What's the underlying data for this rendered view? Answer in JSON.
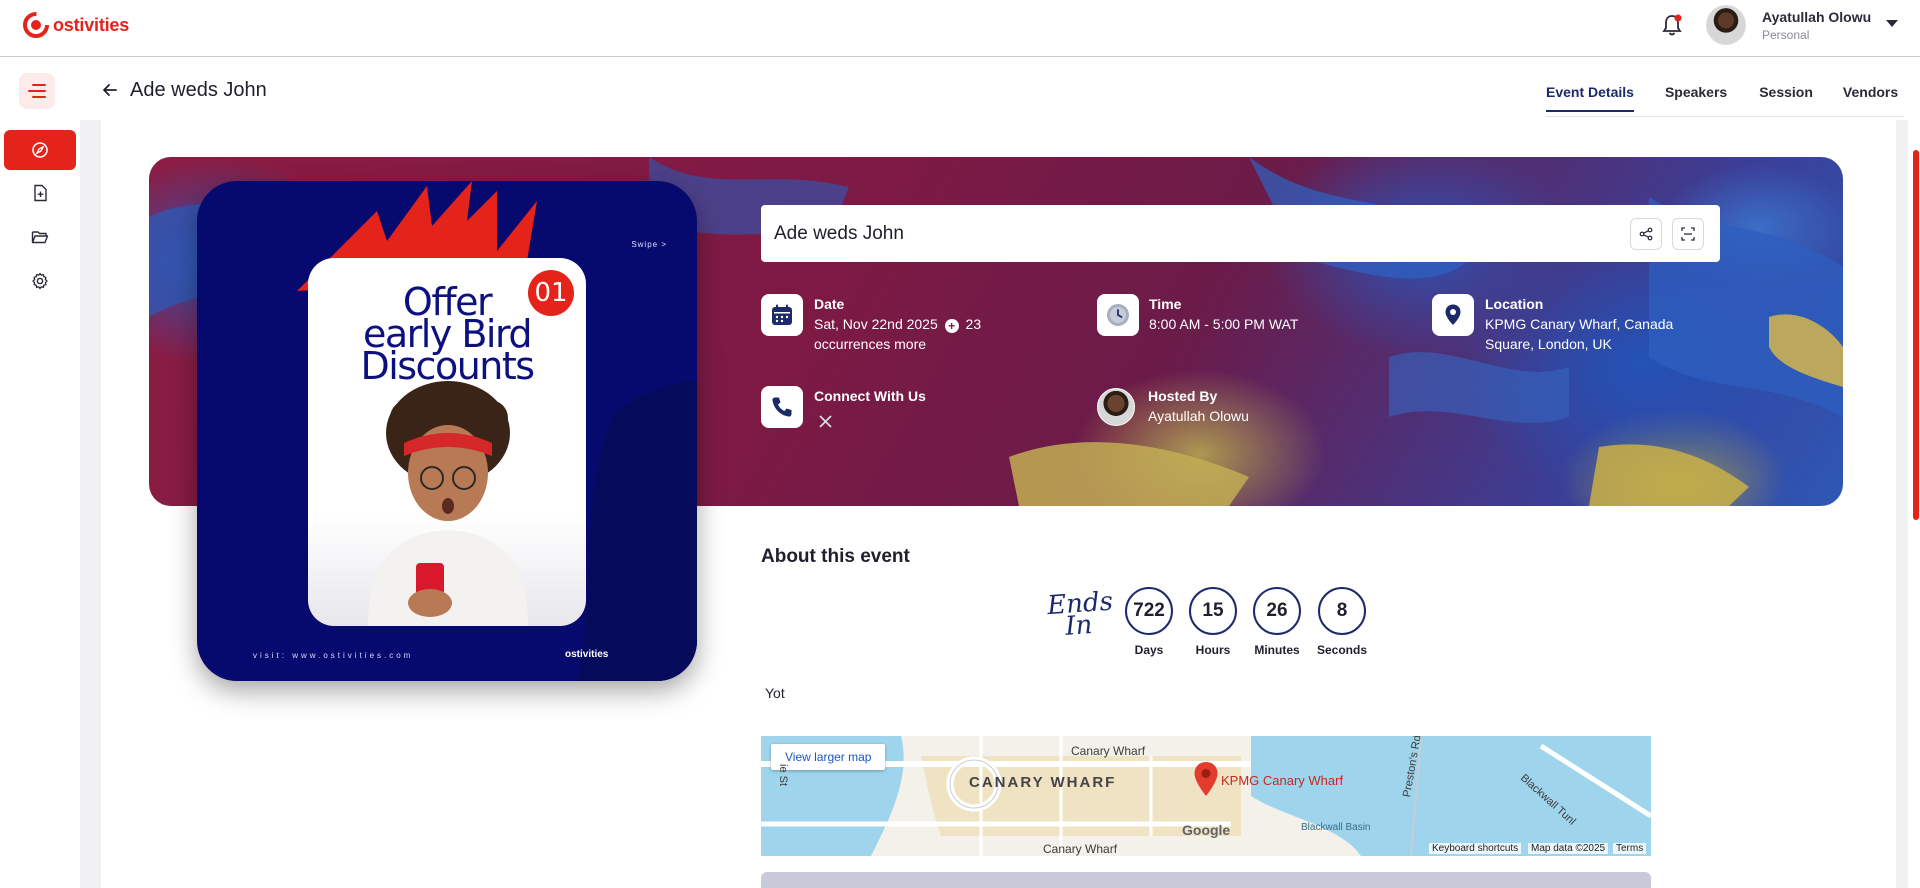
{
  "header": {
    "logo_text": "ostivities",
    "user_name": "Ayatullah Olowu",
    "user_role": "Personal"
  },
  "page": {
    "title": "Ade weds John",
    "tabs": [
      {
        "label": "Event Details",
        "active": true
      },
      {
        "label": "Speakers",
        "active": false
      },
      {
        "label": "Session",
        "active": false
      },
      {
        "label": "Vendors",
        "active": false
      }
    ]
  },
  "poster": {
    "swipe": "Swipe >",
    "badge": "01",
    "headline_1": "Offer",
    "headline_2": "early Bird",
    "headline_3": "Discounts",
    "footer_left": "visit: www.ostivities.com",
    "footer_right": "ostivities"
  },
  "event": {
    "title": "Ade weds John",
    "date_label": "Date",
    "date_value": "Sat, Nov 22nd 2025",
    "date_more": "23 occurrences more",
    "time_label": "Time",
    "time_value": "8:00 AM - 5:00 PM WAT",
    "location_label": "Location",
    "location_value": "KPMG Canary Wharf, Canada Square, London, UK",
    "connect_label": "Connect With Us",
    "hosted_label": "Hosted By",
    "hosted_value": "Ayatullah Olowu"
  },
  "about": {
    "title": "About this event",
    "ends_in": "Ends In",
    "countdown": [
      {
        "value": "722",
        "label": "Days"
      },
      {
        "value": "15",
        "label": "Hours"
      },
      {
        "value": "26",
        "label": "Minutes"
      },
      {
        "value": "8",
        "label": "Seconds"
      }
    ],
    "description": "Yot"
  },
  "map": {
    "view_larger": "View larger map",
    "area_label": "CANARY WHARF",
    "station_top": "Canary Wharf",
    "station_bottom": "Canary Wharf",
    "pin_label": "KPMG Canary Wharf",
    "basin": "Blackwall Basin",
    "road_1": "Preston's Rd",
    "road_2": "Blackwall Tunl",
    "google": "Google",
    "shortcuts": "Keyboard shortcuts",
    "map_data": "Map data ©2025",
    "terms": "Terms",
    "street_partial": "ie St"
  },
  "colors": {
    "brand_red": "#e4231b",
    "navy": "#1c2a6b"
  }
}
